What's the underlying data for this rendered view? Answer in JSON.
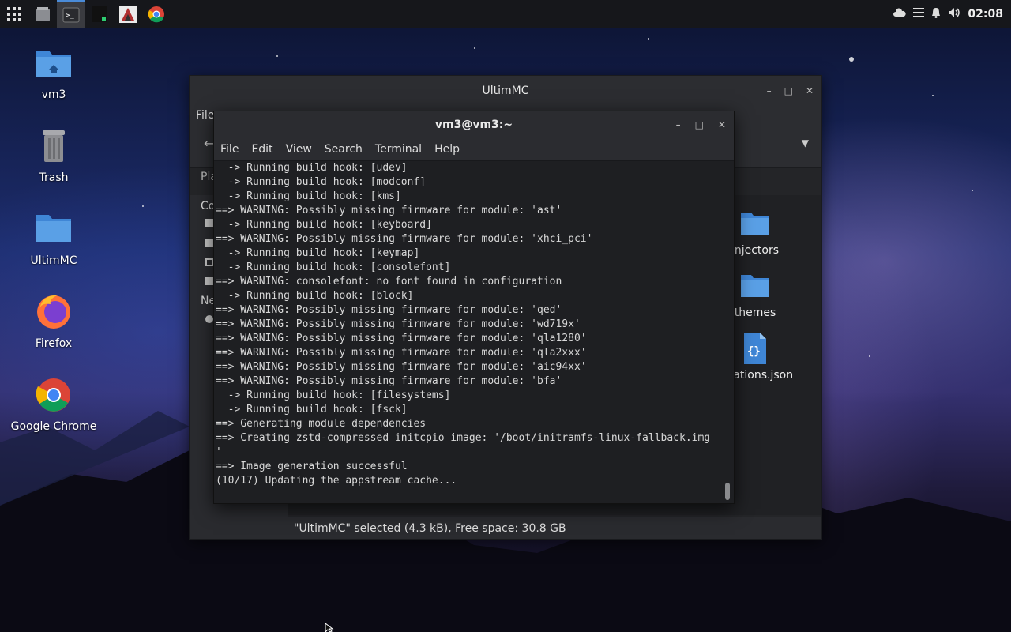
{
  "topbar": {
    "apps": [
      "app-grid-icon",
      "file-manager-icon",
      "terminal-icon",
      "system-monitor-icon",
      "ultimmc-icon",
      "chrome-icon"
    ],
    "clock": "02:08"
  },
  "desktop": {
    "icons": [
      {
        "label": "vm3",
        "icon": "home-folder-icon"
      },
      {
        "label": "Trash",
        "icon": "trash-icon"
      },
      {
        "label": "UltimMC",
        "icon": "folder-icon"
      },
      {
        "label": "Firefox",
        "icon": "firefox-icon"
      },
      {
        "label": "Google Chrome",
        "icon": "chrome-icon"
      }
    ]
  },
  "file_manager": {
    "title": "UltimMC",
    "menu_first": "File",
    "places_label": "Pla",
    "sidebar_frag": [
      "Co",
      "Ne"
    ],
    "items": [
      {
        "label": "injectors",
        "icon": "folder-icon"
      },
      {
        "label": "themes",
        "icon": "folder-icon"
      },
      {
        "label": "ifications.json",
        "icon": "json-file-icon"
      }
    ],
    "status": "\"UltimMC\" selected (4.3 kB), Free space: 30.8 GB"
  },
  "terminal": {
    "title": "vm3@vm3:~",
    "menu": [
      "File",
      "Edit",
      "View",
      "Search",
      "Terminal",
      "Help"
    ],
    "lines": [
      "  -> Running build hook: [udev]",
      "  -> Running build hook: [modconf]",
      "  -> Running build hook: [kms]",
      "==> WARNING: Possibly missing firmware for module: 'ast'",
      "  -> Running build hook: [keyboard]",
      "==> WARNING: Possibly missing firmware for module: 'xhci_pci'",
      "  -> Running build hook: [keymap]",
      "  -> Running build hook: [consolefont]",
      "==> WARNING: consolefont: no font found in configuration",
      "  -> Running build hook: [block]",
      "==> WARNING: Possibly missing firmware for module: 'qed'",
      "==> WARNING: Possibly missing firmware for module: 'wd719x'",
      "==> WARNING: Possibly missing firmware for module: 'qla1280'",
      "==> WARNING: Possibly missing firmware for module: 'qla2xxx'",
      "==> WARNING: Possibly missing firmware for module: 'aic94xx'",
      "==> WARNING: Possibly missing firmware for module: 'bfa'",
      "  -> Running build hook: [filesystems]",
      "  -> Running build hook: [fsck]",
      "==> Generating module dependencies",
      "==> Creating zstd-compressed initcpio image: '/boot/initramfs-linux-fallback.img",
      "'",
      "==> Image generation successful",
      "(10/17) Updating the appstream cache..."
    ]
  },
  "colors": {
    "accent": "#4a8bd8",
    "folder": "#5aa0e6"
  }
}
